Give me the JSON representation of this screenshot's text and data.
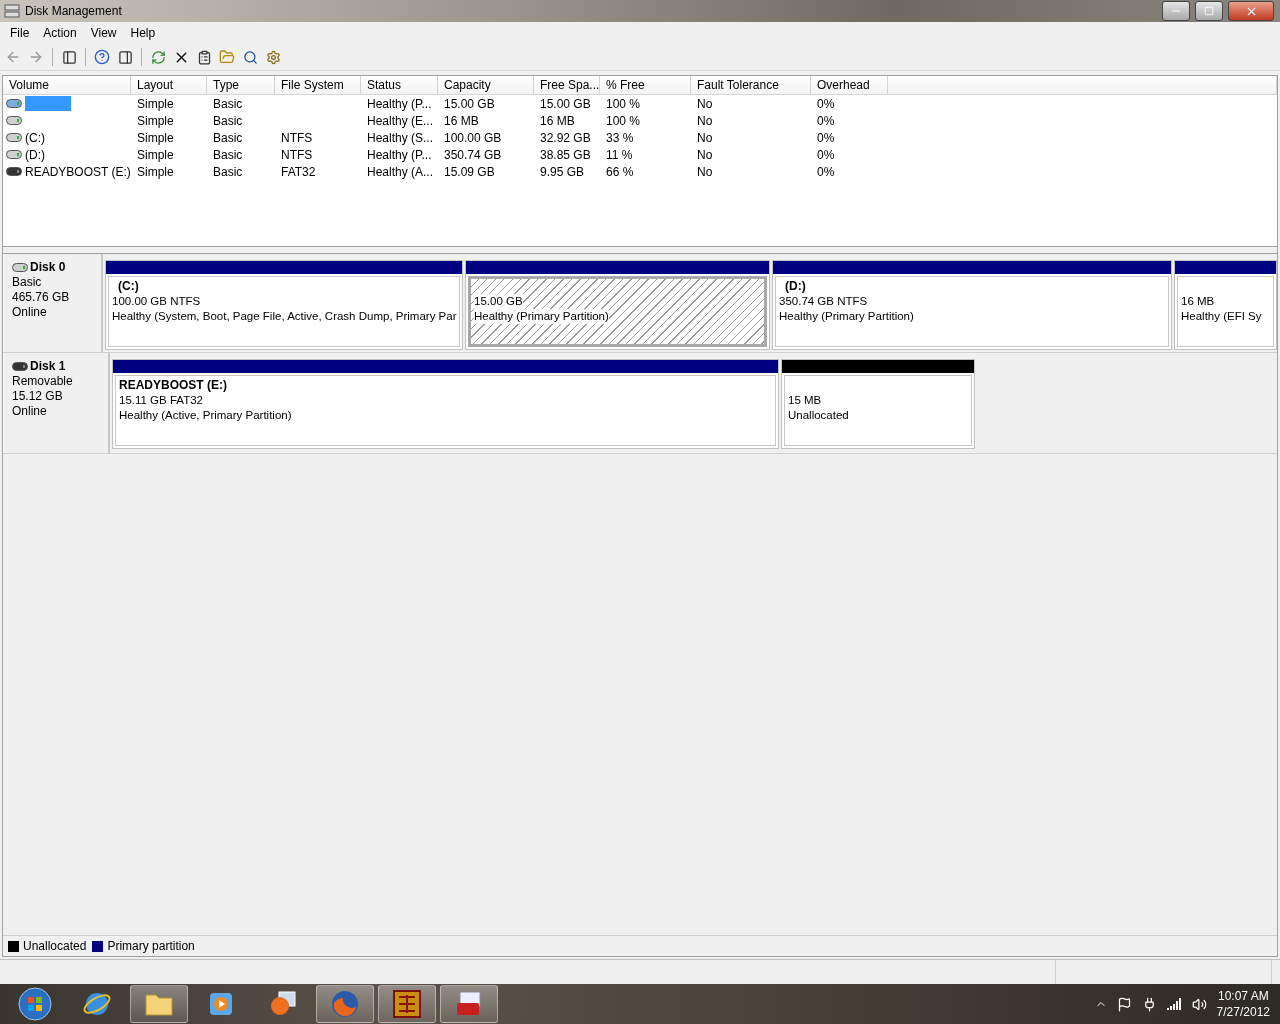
{
  "window": {
    "title": "Disk Management"
  },
  "menu": [
    "File",
    "Action",
    "View",
    "Help"
  ],
  "volume_list": {
    "columns": [
      "Volume",
      "Layout",
      "Type",
      "File System",
      "Status",
      "Capacity",
      "Free Spa...",
      "% Free",
      "Fault Tolerance",
      "Overhead"
    ],
    "rows": [
      {
        "kind": "fixed",
        "selected": true,
        "cells": [
          "",
          "Simple",
          "Basic",
          "",
          "Healthy (P...",
          "15.00 GB",
          "15.00 GB",
          "100 %",
          "No",
          "0%"
        ]
      },
      {
        "kind": "fixed",
        "selected": false,
        "cells": [
          "",
          "Simple",
          "Basic",
          "",
          "Healthy (E...",
          "16 MB",
          "16 MB",
          "100 %",
          "No",
          "0%"
        ]
      },
      {
        "kind": "fixed",
        "selected": false,
        "cells": [
          "(C:)",
          "Simple",
          "Basic",
          "NTFS",
          "Healthy (S...",
          "100.00 GB",
          "32.92 GB",
          "33 %",
          "No",
          "0%"
        ]
      },
      {
        "kind": "fixed",
        "selected": false,
        "cells": [
          "(D:)",
          "Simple",
          "Basic",
          "NTFS",
          "Healthy (P...",
          "350.74 GB",
          "38.85 GB",
          "11 %",
          "No",
          "0%"
        ]
      },
      {
        "kind": "removable",
        "selected": false,
        "cells": [
          "READYBOOST (E:)",
          "Simple",
          "Basic",
          "FAT32",
          "Healthy (A...",
          "15.09 GB",
          "9.95 GB",
          "66 %",
          "No",
          "0%"
        ]
      }
    ]
  },
  "disks": [
    {
      "kind": "fixed",
      "name": "Disk 0",
      "type": "Basic",
      "size": "465.76 GB",
      "status": "Online",
      "partitions": [
        {
          "kind": "primary",
          "selected": false,
          "label": "(C:)",
          "size": "100.00 GB NTFS",
          "status": "Healthy (System, Boot, Page File, Active, Crash Dump, Primary Par"
        },
        {
          "kind": "primary",
          "selected": true,
          "size": "15.00 GB",
          "status": "Healthy (Primary Partition)"
        },
        {
          "kind": "primary",
          "selected": false,
          "label": "(D:)",
          "size": "350.74 GB NTFS",
          "status": "Healthy (Primary Partition)"
        },
        {
          "kind": "primary",
          "selected": false,
          "size": "16 MB",
          "status": "Healthy (EFI Sy"
        }
      ]
    },
    {
      "kind": "removable",
      "name": "Disk 1",
      "type": "Removable",
      "size": "15.12 GB",
      "status": "Online",
      "partitions": [
        {
          "kind": "primary",
          "selected": false,
          "label": "READYBOOST  (E:)",
          "size": "15.11 GB FAT32",
          "status": "Healthy (Active, Primary Partition)"
        },
        {
          "kind": "unallocated",
          "selected": false,
          "size": "15 MB",
          "status": "Unallocated"
        }
      ]
    }
  ],
  "legend": [
    {
      "label": "Unallocated",
      "color": "#000000"
    },
    {
      "label": "Primary partition",
      "color": "#000080"
    }
  ],
  "taskbar": {
    "time": "10:07 AM",
    "date": "7/27/2012"
  }
}
